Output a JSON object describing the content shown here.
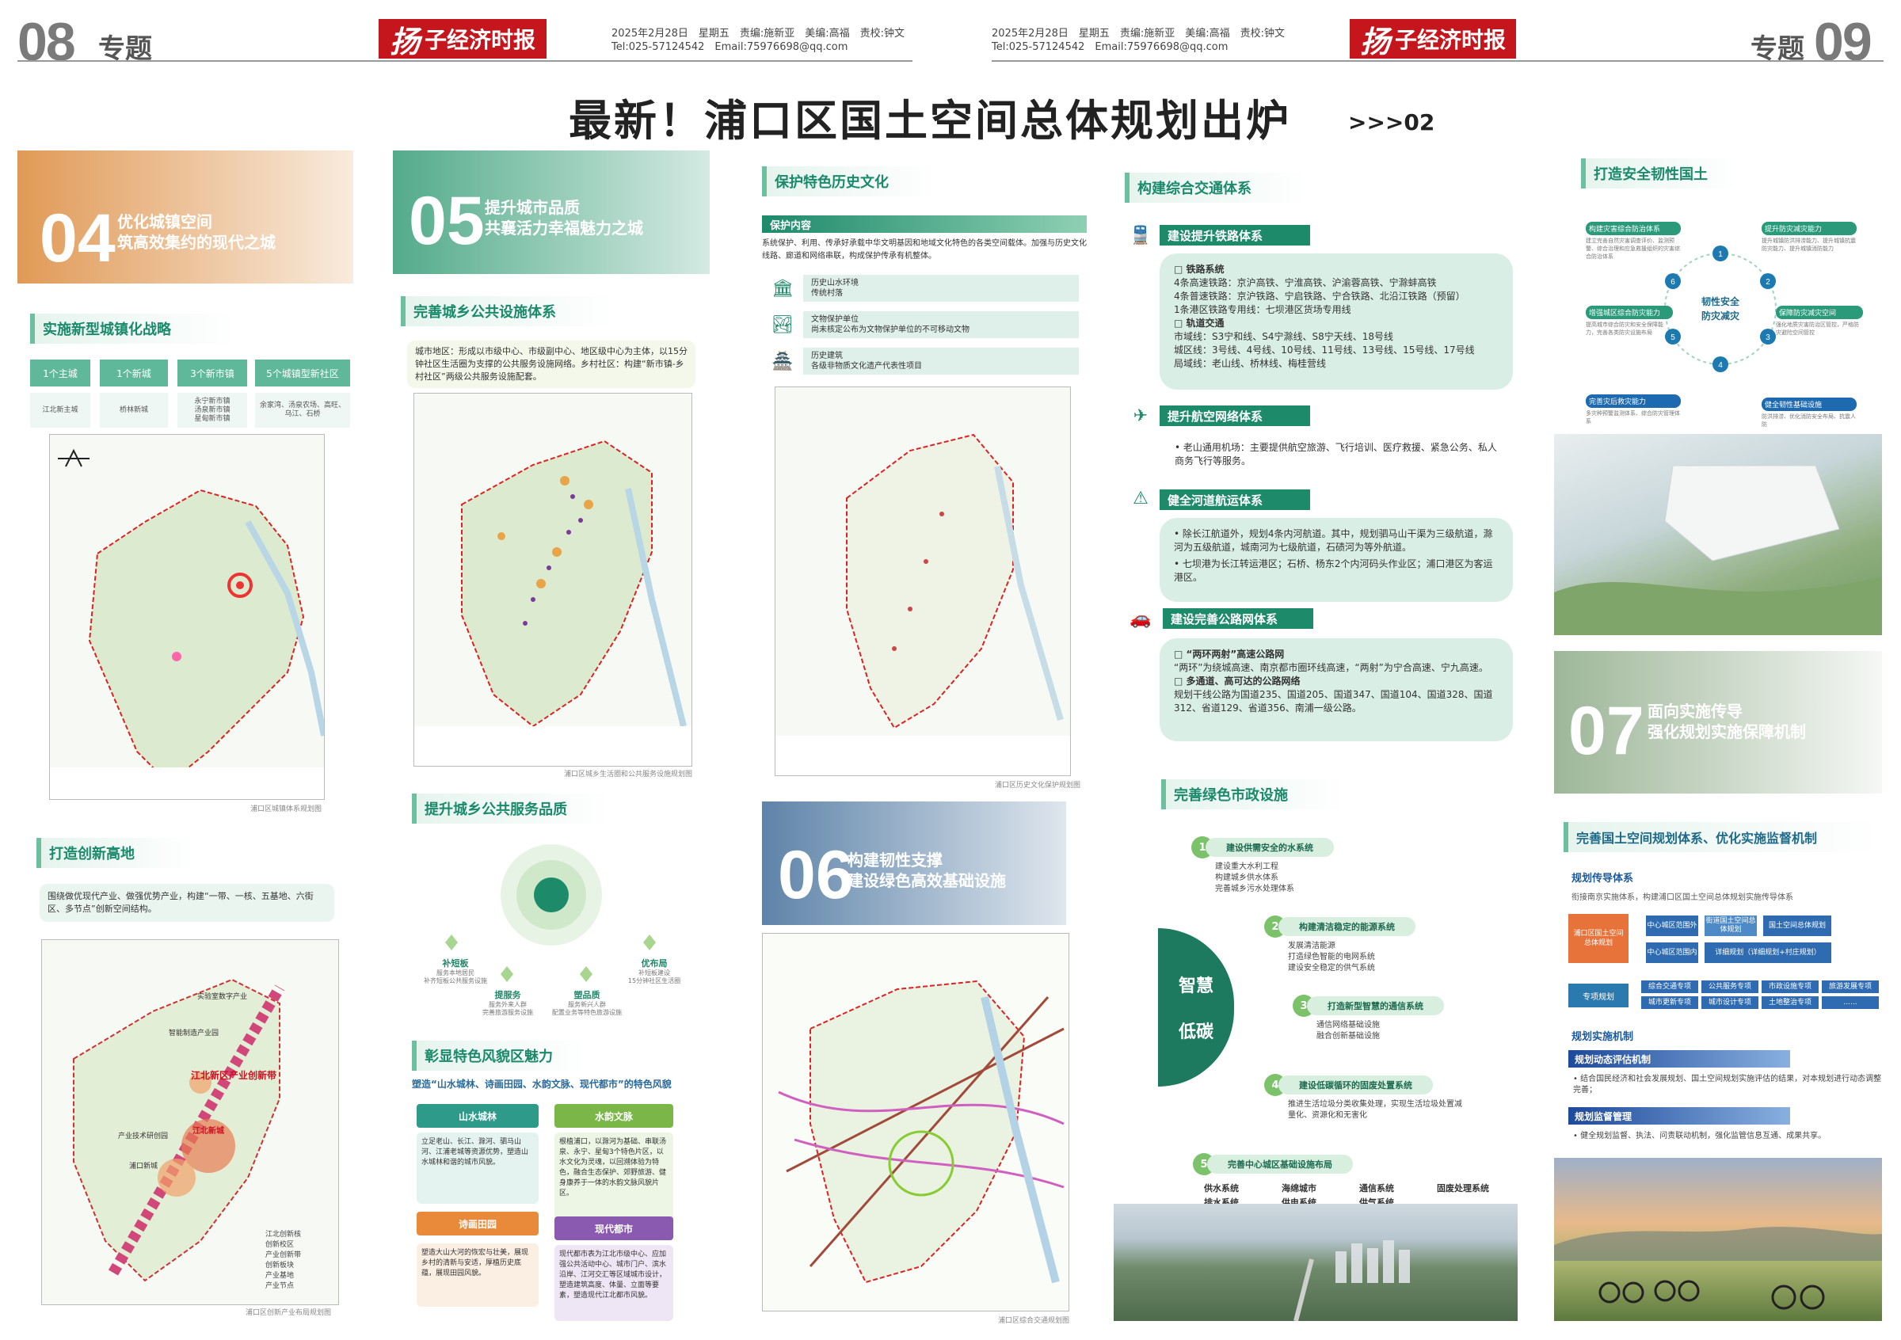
{
  "masthead": {
    "left_page_number": "08",
    "left_section": "专题",
    "right_page_number": "09",
    "right_section": "专题",
    "logo_mark": "扬",
    "logo_text": "子经济时报",
    "meta_line1": "2025年2月28日　星期五　责编:施新亚　美编:高福　责校:钟文",
    "meta_line2": "Tel:025-57124542　Email:75976698@qq.com"
  },
  "headline": {
    "title": "最新！浦口区国土空间总体规划出炉",
    "continued": ">>>02"
  },
  "col1": {
    "banner_number": "04",
    "banner_line1": "优化城镇空间",
    "banner_line2": "筑高效集约的现代之城",
    "strategy_title": "实施新型城镇化战略",
    "chips": [
      "1个主城",
      "1个新城",
      "3个新市镇",
      "5个城镇型新社区"
    ],
    "chip_details": [
      "江北新主城",
      "桥林新城",
      "永宁新市镇\n汤泉新市镇\n星甸新市镇",
      "余家湾、汤泉农场、高旺、\n乌江、石桥"
    ],
    "map1_caption": "浦口区城镇体系规划图",
    "innovation_title": "打造创新高地",
    "innovation_note": "围绕做优现代产业、做强优势产业，构建“一带、一核、五基地、六街区、多节点”创新空间结构。",
    "map2_labels": [
      "江北新区产业创新带",
      "智能制造产业园",
      "实验室数字产业",
      "产业技术研创园",
      "浦口新城",
      "江北新城"
    ],
    "map2_legend": [
      "江北创新核",
      "创新校区",
      "产业创新带",
      "创新板块",
      "产业基地",
      "产业节点"
    ],
    "map2_caption": "浦口区创新产业布局规划图"
  },
  "col2": {
    "banner_number": "05",
    "banner_line1": "提升城市品质",
    "banner_line2": "共襄活力幸福魅力之城",
    "facility_title": "完善城乡公共设施体系",
    "facility_note": "城市地区：形成以市级中心、市级副中心、地区级中心为主体，以15分钟社区生活圈为支撑的公共服务设施网络。乡村社区：构建“新市镇-乡村社区”两级公共服务设施配套。",
    "map_caption": "浦口区城乡生活圈和公共服务设施规划图",
    "service_title": "提升城乡公共服务品质",
    "service_items": [
      {
        "name": "补短板",
        "desc": "服务本地居民\n补齐短板公共服务设施"
      },
      {
        "name": "提服务",
        "desc": "服务外来人群\n完善旅游服务设施"
      },
      {
        "name": "塑品质",
        "desc": "服务新兴人群\n配置业务等特色旅游设施"
      },
      {
        "name": "优布局",
        "desc": "补短板建设\n15分钟社区生活圈"
      }
    ],
    "charm_title": "彰显特色风貌区魅力",
    "charm_subtitle": "塑造“山水城林、诗画田园、水韵文脉、现代都市”的特色风貌",
    "charm_tags": [
      "山水城林",
      "水韵文脉",
      "诗画田园",
      "现代都市"
    ],
    "charm_texts": [
      "立足老山、长江、滁河、驷马山河、江浦老城等资源优势，塑造山水城林和谐的城市风貌。",
      "根植浦口，以滁河为基础、串联汤泉、永宁、星甸3个特色片区，以水文化为灵魂，以回溯体验为特色，融合生态保护、郊野旅游、健身康养于一体的水韵文脉风貌片区。",
      "塑造大山大河的恢宏与壮美，展现乡村的清新与安适，厚植历史底蕴，展现田园风貌。",
      "现代都市表为江北市级中心、应加强公共活动中心、城市门户、滨水沿岸、江河交汇等区域城市设计，塑造建筑高度、体量、立面等要素，塑造现代江北都市风貌。"
    ]
  },
  "col3": {
    "heritage_title": "保护特色历史文化",
    "heritage_bar": "保护内容",
    "heritage_note": "系统保护、利用、传承好承载中华文明基因和地域文化特色的各类空间载体。加强与历史文化线路、廊道和网络串联，构成保护传承有机整体。",
    "heritage_items": [
      {
        "t1": "历史山水环境",
        "t2": "传统村落"
      },
      {
        "t1": "文物保护单位",
        "t2": "尚未核定公布为文物保护单位的不可移动文物"
      },
      {
        "t1": "历史建筑",
        "t2": "各级非物质文化遗产代表性项目"
      }
    ],
    "map_caption": "浦口区历史文化保护规划图",
    "banner_number": "06",
    "banner_line1": "构建韧性支撑",
    "banner_line2": "建设绿色高效基础设施",
    "map2_caption": "浦口区综合交通规划图"
  },
  "col4": {
    "traffic_title": "构建综合交通体系",
    "rail_title": "建设提升铁路体系",
    "rail_lines": [
      "□ 铁路系统",
      "4条高速铁路：京沪高铁、宁淮高铁、沪渝蓉高铁、宁滁蚌高铁",
      "4条普速铁路：京沪铁路、宁启铁路、宁合铁路、北沿江铁路（预留）",
      "1条港区铁路专用线：七坝港区货场专用线",
      "□ 轨道交通",
      "市域线：S3宁和线、S4宁滁线、S8宁天线、18号线",
      "城区线：3号线、4号线、10号线、11号线、13号线、15号线、17号线",
      "局域线：老山线、桥林线、梅桂营线"
    ],
    "air_title": "提升航空网络体系",
    "air_text": "• 老山通用机场：主要提供航空旅游、飞行培训、医疗救援、紧急公务、私人商务飞行等服务。",
    "water_title": "健全河道航运体系",
    "water_text1": "• 除长江航道外，规划4条内河航道。其中，规划驷马山干渠为三级航道，滁河为五级航道，城南河为七级航道，石碛河为等外航道。",
    "water_text2": "• 七坝港为长江转运港区；石桥、杨东2个内河码头作业区；浦口港区为客运港区。",
    "road_title": "建设完善公路网体系",
    "road_lines": [
      "□ “两环两射”高速公路网",
      "“两环”为绕城高速、南京都市圈环线高速，“两射”为宁合高速、宁九高速。",
      "□ 多通道、高可达的公路网络",
      "规划干线公路为国道235、国道205、国道347、国道104、国道328、国道312、省道129、省道356、南浦一级公路。"
    ],
    "green_title": "完善绿色市政设施",
    "smart_label1": "智慧",
    "smart_label2": "低碳",
    "steps": [
      {
        "n": "1",
        "label": "建设供需安全的水系统",
        "items": [
          "建设重大水利工程",
          "构建城乡供水体系",
          "完善城乡污水处理体系"
        ]
      },
      {
        "n": "2",
        "label": "构建清洁稳定的能源系统",
        "items": [
          "发展清洁能源",
          "打造绿色智能的电网系统",
          "建设安全稳定的供气系统"
        ]
      },
      {
        "n": "3",
        "label": "打造新型智慧的通信系统",
        "items": [
          "通信网络基础设施",
          "融合创新基础设施"
        ]
      },
      {
        "n": "4",
        "label": "建设低碳循环的固废处置系统",
        "items": [
          "推进生活垃圾分类收集处理，实现生活垃圾处置减量化、资源化和无害化"
        ]
      },
      {
        "n": "5",
        "label": "完善中心城区基础设施布局",
        "items": [
          "供水系统",
          "海绵城市",
          "通信系统",
          "固废处理系统",
          "排水系统",
          "供电系统",
          "供气系统"
        ]
      }
    ]
  },
  "col5": {
    "safety_title": "打造安全韧性国土",
    "center_label1": "韧性安全",
    "center_label2": "防灾减灾",
    "cards": [
      {
        "title": "构建灾害综合防治体系",
        "text": "建立完善自然灾害调查评价、监测预警、综合治理和应急救援组织的灾害综合防治体系"
      },
      {
        "title": "提升防灾减灾能力",
        "text": "提升城镇防洪排涝能力、提升城镇抗震防灾能力、提升城镇消防能力"
      },
      {
        "title": "增强城区综合防灾能力",
        "text": "提高城市综合防灾和安全保障能力，完善各类防灾设施布局"
      },
      {
        "title": "保障防灾减灾空间",
        "text": "强化地质灾害防治区管控，严格防灾避险空间管控"
      },
      {
        "title": "完善灾后救灾能力",
        "text": "多灾种预警监测体系、综合防灾管理体系"
      },
      {
        "title": "健全韧性基础设施",
        "text": "防洪排涝、优化消防安全布局、抗震人防"
      }
    ],
    "banner_number": "07",
    "banner_line1": "面向实施传导",
    "banner_line2": "强化规划实施保障机制",
    "monitor_title": "完善国土空间规划体系、优化实施监督机制",
    "transmit_title": "规划传导体系",
    "transmit_note": "衔接南京实施体系，构建浦口区国土空间总体规划实施传导体系",
    "flow_main": "浦口区国土空间总体规划",
    "flow_mid": [
      "中心城区范围外",
      "中心城区范围内"
    ],
    "flow_right": [
      "国土空间总体规划",
      "详细规划（详细规划+村庄规划）"
    ],
    "flow_small": [
      "街道国土空间总体规划",
      "编制单元"
    ],
    "flow_special": "专项规划",
    "flow_bottom": [
      "综合交通专项",
      "公共服务专项",
      "市政设施专项",
      "旅游发展专项",
      "城市更新专项",
      "城市设计专项",
      "土地整治专项",
      "......"
    ],
    "implement_title": "规划实施机制",
    "eval_bar": "规划动态评估机制",
    "eval_text": "• 结合国民经济和社会发展规划、国土空间规划实施评估的结果，对本规划进行动态调整完善；",
    "supervise_bar": "规划监督管理",
    "supervise_text": "• 健全规划监督、执法、问责联动机制，强化监管信息互通、成果共享。"
  },
  "colors": {
    "brand_red": "#c4161c",
    "primary_green": "#1d8a6a",
    "light_green": "#d9efe6"
  }
}
